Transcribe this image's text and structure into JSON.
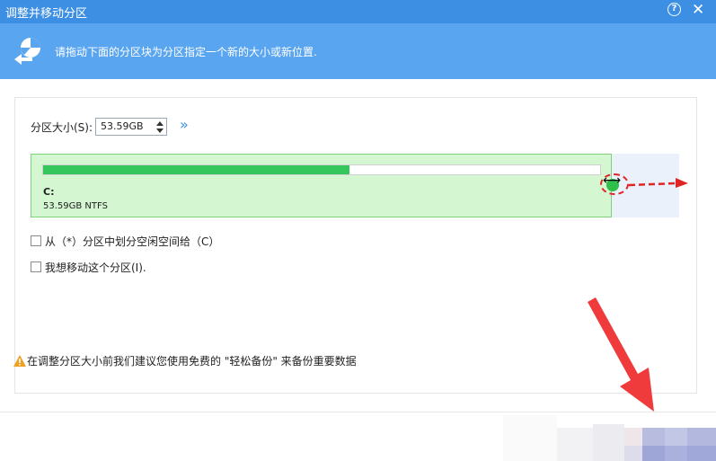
{
  "window": {
    "title": "调整并移动分区",
    "help_icon": "help-icon",
    "close_icon": "close-icon"
  },
  "banner": {
    "icon": "partition-move-icon",
    "text": "请拖动下面的分区块为分区指定一个新的大小或新位置."
  },
  "size": {
    "label": "分区大小(S):",
    "value": "53.59GB",
    "more_icon": "double-chevron-right-icon"
  },
  "partition": {
    "name": "C:",
    "info": "53.59GB NTFS",
    "used_fraction": 0.55,
    "colors": {
      "block": "#d4f6d1",
      "used": "#35c75b",
      "free_track": "#eaf1fb"
    }
  },
  "options": {
    "allocate_label": "从（*）分区中划分空闲空间给（C）",
    "allocate_checked": false,
    "move_label": "我想移动这个分区(I).",
    "move_checked": false
  },
  "tip": {
    "icon": "warning-icon",
    "text": "在调整分区大小前我们建议您使用免费的 \"轻松备份\" 来备份重要数据"
  },
  "colors": {
    "titlebar": "#3d8fe4",
    "banner": "#5aa5f0",
    "annotation": "#e02424"
  }
}
